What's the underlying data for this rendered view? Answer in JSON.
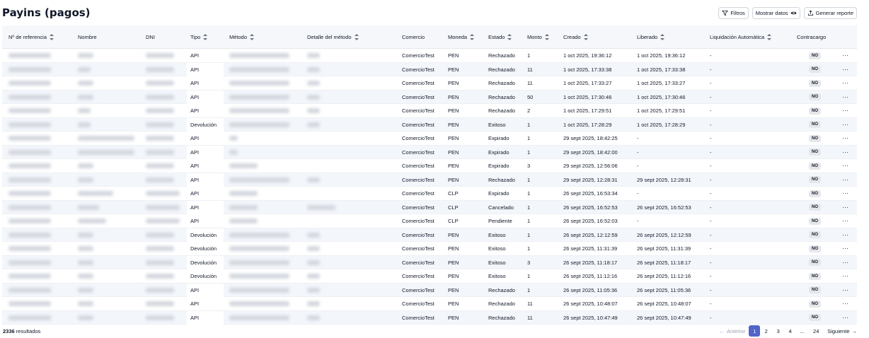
{
  "title": "Payins (pagos)",
  "toolbar": {
    "filters": "Filtros",
    "show_data": "Mostrar datos",
    "report": "Generar reporte"
  },
  "columns": [
    "Nº de referencia",
    "Nombre",
    "DNI",
    "Tipo",
    "Método",
    "Detalle del método",
    "Comercio",
    "Moneda",
    "Estado",
    "Monto",
    "Creado",
    "Liberado",
    "Liquidación Automática",
    "Contracargo"
  ],
  "rows": [
    {
      "tipo": "API",
      "comercio": "ComercioTest",
      "moneda": "PEN",
      "estado": "Rechazado",
      "monto": "1",
      "creado": "1 oct 2025, 19:36:12",
      "liberado": "1 oct 2025, 19:36:12",
      "liq": "-",
      "contra": "NO"
    },
    {
      "tipo": "API",
      "comercio": "ComercioTest",
      "moneda": "PEN",
      "estado": "Rechazado",
      "monto": "11",
      "creado": "1 oct 2025, 17:33:38",
      "liberado": "1 oct 2025, 17:33:38",
      "liq": "-",
      "contra": "NO"
    },
    {
      "tipo": "API",
      "comercio": "ComercioTest",
      "moneda": "PEN",
      "estado": "Rechazado",
      "monto": "11",
      "creado": "1 oct 2025, 17:33:27",
      "liberado": "1 oct 2025, 17:33:27",
      "liq": "-",
      "contra": "NO"
    },
    {
      "tipo": "API",
      "comercio": "ComercioTest",
      "moneda": "PEN",
      "estado": "Rechazado",
      "monto": "50",
      "creado": "1 oct 2025, 17:30:46",
      "liberado": "1 oct 2025, 17:30:46",
      "liq": "-",
      "contra": "NO"
    },
    {
      "tipo": "API",
      "comercio": "ComercioTest",
      "moneda": "PEN",
      "estado": "Rechazado",
      "monto": "2",
      "creado": "1 oct 2025, 17:29:51",
      "liberado": "1 oct 2025, 17:29:51",
      "liq": "-",
      "contra": "NO"
    },
    {
      "tipo": "Devolución",
      "comercio": "ComercioTest",
      "moneda": "PEN",
      "estado": "Exitoso",
      "monto": "1",
      "creado": "1 oct 2025, 17:28:29",
      "liberado": "1 oct 2025, 17:28:29",
      "liq": "-",
      "contra": "NO"
    },
    {
      "tipo": "API",
      "comercio": "ComercioTest",
      "moneda": "PEN",
      "estado": "Expirado",
      "monto": "1",
      "creado": "29 sept 2025, 18:42:25",
      "liberado": "-",
      "liq": "-",
      "contra": "NO"
    },
    {
      "tipo": "API",
      "comercio": "ComercioTest",
      "moneda": "PEN",
      "estado": "Expirado",
      "monto": "1",
      "creado": "29 sept 2025, 18:42:00",
      "liberado": "-",
      "liq": "-",
      "contra": "NO"
    },
    {
      "tipo": "API",
      "comercio": "ComercioTest",
      "moneda": "PEN",
      "estado": "Expirado",
      "monto": "3",
      "creado": "29 sept 2025, 12:56:06",
      "liberado": "-",
      "liq": "-",
      "contra": "NO"
    },
    {
      "tipo": "API",
      "comercio": "ComercioTest",
      "moneda": "PEN",
      "estado": "Rechazado",
      "monto": "1",
      "creado": "29 sept 2025, 12:28:31",
      "liberado": "29 sept 2025, 12:28:31",
      "liq": "-",
      "contra": "NO"
    },
    {
      "tipo": "API",
      "comercio": "ComercioTest",
      "moneda": "CLP",
      "estado": "Expirado",
      "monto": "1",
      "creado": "26 sept 2025, 16:53:34",
      "liberado": "-",
      "liq": "-",
      "contra": "NO"
    },
    {
      "tipo": "API",
      "comercio": "ComercioTest",
      "moneda": "CLP",
      "estado": "Cancelado",
      "monto": "1",
      "creado": "26 sept 2025, 16:52:53",
      "liberado": "26 sept 2025, 16:52:53",
      "liq": "-",
      "contra": "NO"
    },
    {
      "tipo": "API",
      "comercio": "ComercioTest",
      "moneda": "CLP",
      "estado": "Pendiente",
      "monto": "1",
      "creado": "26 sept 2025, 16:52:03",
      "liberado": "-",
      "liq": "-",
      "contra": "NO"
    },
    {
      "tipo": "Devolución",
      "comercio": "ComercioTest",
      "moneda": "PEN",
      "estado": "Exitoso",
      "monto": "1",
      "creado": "26 sept 2025, 12:12:59",
      "liberado": "26 sept 2025, 12:12:59",
      "liq": "-",
      "contra": "NO"
    },
    {
      "tipo": "Devolución",
      "comercio": "ComercioTest",
      "moneda": "PEN",
      "estado": "Exitoso",
      "monto": "1",
      "creado": "26 sept 2025, 11:31:39",
      "liberado": "26 sept 2025, 11:31:39",
      "liq": "-",
      "contra": "NO"
    },
    {
      "tipo": "Devolución",
      "comercio": "ComercioTest",
      "moneda": "PEN",
      "estado": "Exitoso",
      "monto": "3",
      "creado": "26 sept 2025, 11:18:17",
      "liberado": "26 sept 2025, 11:18:17",
      "liq": "-",
      "contra": "NO"
    },
    {
      "tipo": "Devolución",
      "comercio": "ComercioTest",
      "moneda": "PEN",
      "estado": "Exitoso",
      "monto": "1",
      "creado": "26 sept 2025, 11:12:16",
      "liberado": "26 sept 2025, 11:12:16",
      "liq": "-",
      "contra": "NO"
    },
    {
      "tipo": "API",
      "comercio": "ComercioTest",
      "moneda": "PEN",
      "estado": "Rechazado",
      "monto": "1",
      "creado": "26 sept 2025, 11:05:36",
      "liberado": "26 sept 2025, 11:05:36",
      "liq": "-",
      "contra": "NO"
    },
    {
      "tipo": "API",
      "comercio": "ComercioTest",
      "moneda": "PEN",
      "estado": "Rechazado",
      "monto": "11",
      "creado": "26 sept 2025, 10:48:07",
      "liberado": "26 sept 2025, 10:48:07",
      "liq": "-",
      "contra": "NO"
    },
    {
      "tipo": "API",
      "comercio": "ComercioTest",
      "moneda": "PEN",
      "estado": "Rechazado",
      "monto": "11",
      "creado": "26 sept 2025, 10:47:49",
      "liberado": "26 sept 2025, 10:47:49",
      "liq": "-",
      "contra": "NO"
    }
  ],
  "footer": {
    "count": "2336",
    "count_label": "resultados"
  },
  "pagination": {
    "prev": "Anterior",
    "next": "Siguiente",
    "pages": [
      "1",
      "2",
      "3",
      "4",
      "...",
      "24"
    ],
    "current": "1"
  },
  "colors": {
    "accent": "#5164c8",
    "header_bg": "#f5f7fa",
    "row_alt": "#f3f6fb"
  }
}
